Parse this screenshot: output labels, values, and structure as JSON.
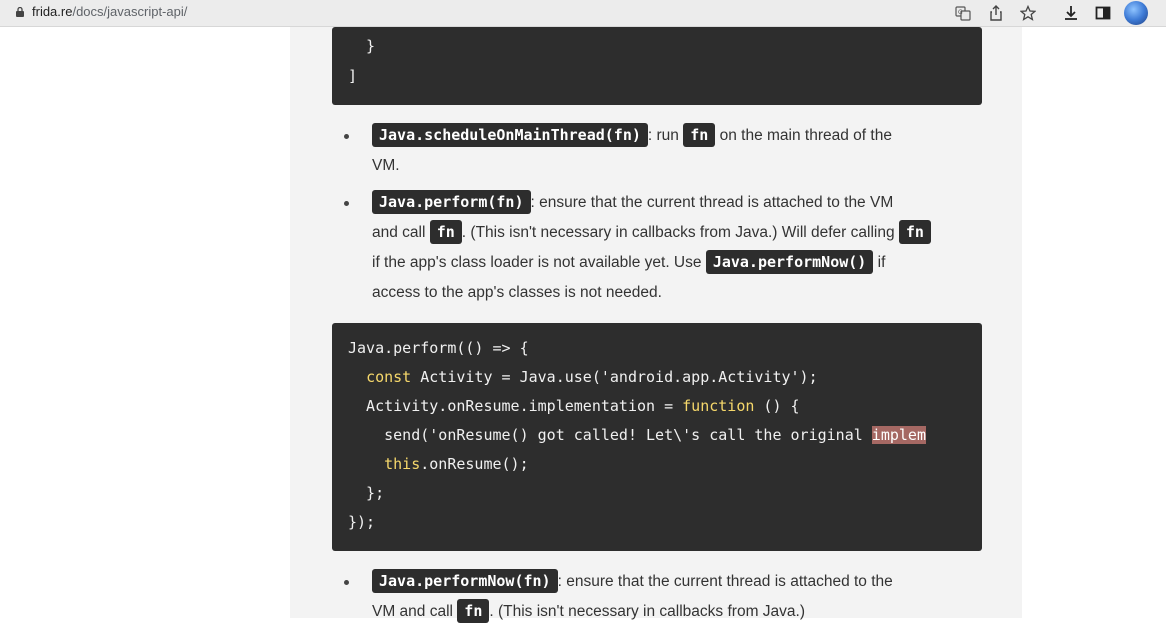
{
  "browser": {
    "url_domain": "frida.re",
    "url_path": "/docs/javascript-api/"
  },
  "top_code": {
    "line1": "  }",
    "line2": "]"
  },
  "items": [
    {
      "code": "Java.scheduleOnMainThread(fn)",
      "t1": ": run ",
      "code2": "fn",
      "t2": " on the main thread of the",
      "t3": "VM."
    },
    {
      "code": "Java.perform(fn)",
      "t1": ": ensure that the current thread is attached to the VM",
      "t2": "and call ",
      "code2": "fn",
      "t3": ". (This isn't necessary in callbacks from Java.) Will defer calling ",
      "code3": "fn",
      "t4": "if the app's class loader is not available yet. Use ",
      "code4": "Java.performNow()",
      "t5": " if",
      "t6": "access to the app's classes is not needed."
    },
    {
      "code": "Java.performNow(fn)",
      "t1": ": ensure that the current thread is attached to the",
      "t2": "VM and call ",
      "code2": "fn",
      "t3": ". (This isn't necessary in callbacks from Java.)"
    }
  ],
  "example_code": {
    "l1": "Java.perform(() => {",
    "l2a": "  ",
    "l2kw": "const",
    "l2b": " Activity = Java.use('android.app.Activity');",
    "l3a": "  Activity.onResume.implementation = ",
    "l3kw": "function",
    "l3b": " () {",
    "l4a": "    send('onResume() got called! Let\\'s call the original ",
    "l4hl": "implem",
    "l5a": "    ",
    "l5kw": "this",
    "l5b": ".onResume();",
    "l6": "  };",
    "l7": "});"
  }
}
